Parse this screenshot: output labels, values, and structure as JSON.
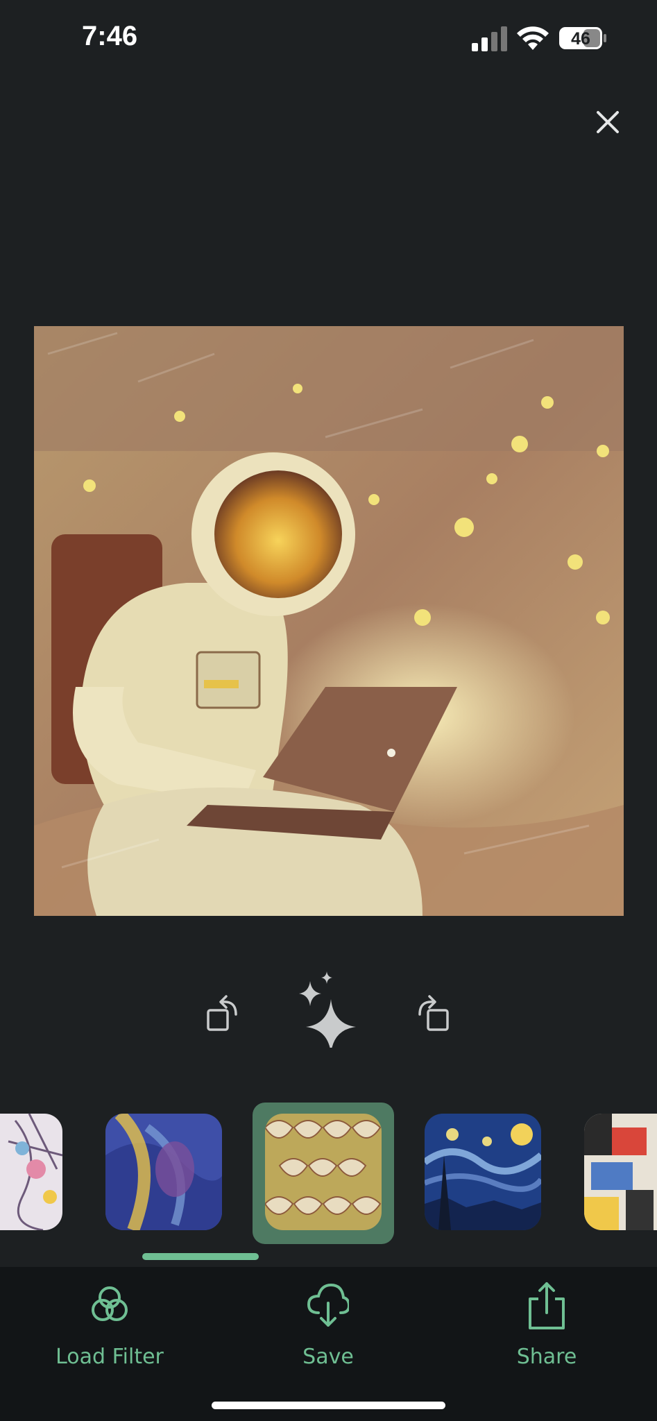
{
  "status": {
    "time": "7:46",
    "battery": "46"
  },
  "colors": {
    "background": "#1d2022",
    "accent": "#6fbf93",
    "selected_frame": "#4e7a62",
    "tab_bar": "#121517"
  },
  "icons": {
    "close": "close-icon",
    "rotate_left": "rotate-left-icon",
    "magic": "sparkles-icon",
    "rotate_right": "rotate-right-icon"
  },
  "filters": {
    "items": [
      "mosaic-pattern",
      "portrait-swirl",
      "art-deco-pattern",
      "starry-night",
      "collage"
    ],
    "selected_index": 2
  },
  "tabbar": {
    "load_filter_label": "Load Filter",
    "save_label": "Save",
    "share_label": "Share"
  }
}
